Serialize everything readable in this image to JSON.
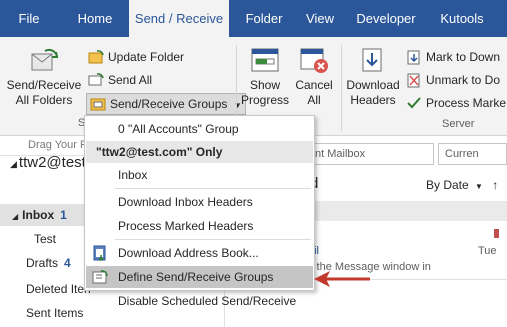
{
  "tabs": [
    {
      "label": "File"
    },
    {
      "label": "Home"
    },
    {
      "label": "Send / Receive"
    },
    {
      "label": "Folder"
    },
    {
      "label": "View"
    },
    {
      "label": "Developer"
    },
    {
      "label": "Kutools"
    }
  ],
  "ribbon": {
    "send_receive_all": {
      "line1": "Send/Receive",
      "line2": "All Folders"
    },
    "update_folder": "Update Folder",
    "send_all": "Send All",
    "send_receive_groups": "Send/Receive Groups",
    "group_label_partial": "S",
    "show_progress": {
      "line1": "Show",
      "line2": "Progress"
    },
    "cancel_all": {
      "line1": "Cancel",
      "line2": "All"
    },
    "download_headers": {
      "line1": "Download",
      "line2": "Headers"
    },
    "mark_to_download": "Mark to Down",
    "unmark_to_download": "Unmark to Do",
    "process_marked": "Process Marke",
    "server_group_label": "Server"
  },
  "leftpane": {
    "drag_hint": "Drag Your F",
    "account": "ttw2@test",
    "items": [
      {
        "label": "Inbox",
        "count": "1"
      },
      {
        "label": "Test",
        "count": ""
      },
      {
        "label": "Drafts",
        "count": "4"
      },
      {
        "label": "Deleted Iten",
        "count": ""
      },
      {
        "label": "Sent Items",
        "count": ""
      }
    ]
  },
  "rightpane": {
    "search_scope": "nt Mailbox",
    "search_current": "Curren",
    "heading_partial": "d",
    "sort_label": "By Date",
    "sort_order": "↑",
    "mail_partial": "ail",
    "mail_preview": "it the Message window in",
    "mail_day": "Tue"
  },
  "menu": {
    "items": [
      {
        "label": "0 \"All Accounts\" Group",
        "type": "item"
      },
      {
        "label": "\"ttw2@test.com\" Only",
        "type": "header"
      },
      {
        "label": "Inbox",
        "type": "item"
      },
      {
        "label": "Download Inbox Headers",
        "type": "item"
      },
      {
        "label": "Process Marked Headers",
        "type": "item"
      },
      {
        "label": "Download Address Book...",
        "type": "item"
      },
      {
        "label": "Define Send/Receive Groups",
        "type": "item"
      },
      {
        "label": "Disable Scheduled Send/Receive",
        "type": "item"
      }
    ]
  },
  "colors": {
    "ribbon_blue": "#2b579a",
    "arrow_red": "#c0392b",
    "highlight": "#c5c5c5"
  }
}
